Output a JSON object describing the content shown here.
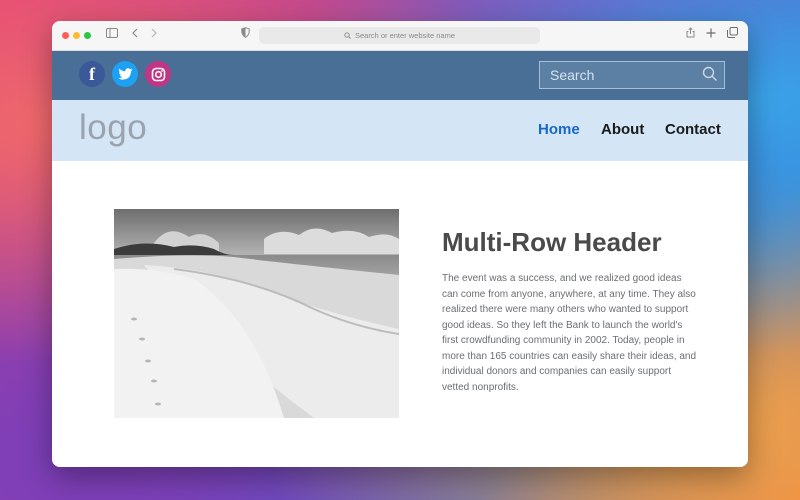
{
  "browser": {
    "address_placeholder": "Search or enter website name"
  },
  "topbar": {
    "social": [
      {
        "name": "facebook-icon",
        "glyph": "f",
        "color": "#3b5998"
      },
      {
        "name": "twitter-icon",
        "glyph": "t",
        "color": "#1da1f2"
      },
      {
        "name": "instagram-icon",
        "glyph": "◎",
        "color": "#c13584"
      }
    ],
    "search_placeholder": "Search"
  },
  "navbar": {
    "logo": "logo",
    "links": [
      "Home",
      "About",
      "Contact"
    ],
    "active": "Home"
  },
  "main": {
    "title": "Multi-Row Header",
    "body": "The event was a success, and we realized good ideas can come from anyone, anywhere, at any time. They also realized there were many others who wanted to support good ideas. So they left the Bank to launch the world's first crowdfunding community in 2002. Today, people in more than 165 countries can easily share their ideas, and individual donors and companies can easily support vetted nonprofits."
  },
  "colors": {
    "topbar": "#4a6f97",
    "navbar": "#d4e5f6",
    "active_link": "#1868c9"
  }
}
